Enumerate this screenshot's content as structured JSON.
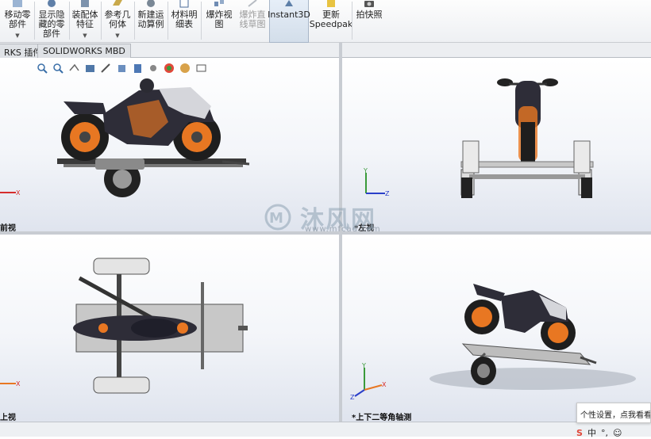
{
  "ribbon": {
    "items": [
      {
        "label": "移动零\n部件",
        "has_dropdown": true
      },
      {
        "label": "显示隐\n藏的零\n部件",
        "has_dropdown": false
      },
      {
        "label": "装配体\n特征",
        "has_dropdown": true
      },
      {
        "label": "参考几\n何体",
        "has_dropdown": true
      },
      {
        "label": "新建运\n动算例",
        "has_dropdown": false
      },
      {
        "label": "材料明\n细表",
        "has_dropdown": false
      },
      {
        "label": "爆炸视\n图",
        "has_dropdown": false
      },
      {
        "label": "爆炸直\n线草图",
        "disabled": true
      },
      {
        "label": "Instant3D",
        "active": true
      },
      {
        "label": "更新\nSpeedpak"
      },
      {
        "label": "拍快照"
      }
    ]
  },
  "tabs": [
    {
      "label": "RKS 插件"
    },
    {
      "label": "SOLIDWORKS MBD"
    }
  ],
  "viewports": {
    "front": {
      "label": "前视"
    },
    "left": {
      "label": "*左视"
    },
    "top": {
      "label": "上视"
    },
    "iso": {
      "label": "*上下二等角轴测"
    }
  },
  "watermark": {
    "brand": "沐风网",
    "url": "www.mfcad.com"
  },
  "tooltip": {
    "text": "个性设置，点我看看"
  },
  "tray": {
    "items": [
      "中",
      "°,",
      "☺"
    ]
  },
  "colors": {
    "accent": "#e87722",
    "frame": "#d0d0d0",
    "dark": "#2b2b33",
    "axis_x": "#d62d2d",
    "axis_y": "#3a9a3a",
    "axis_z": "#2b3fc9"
  }
}
